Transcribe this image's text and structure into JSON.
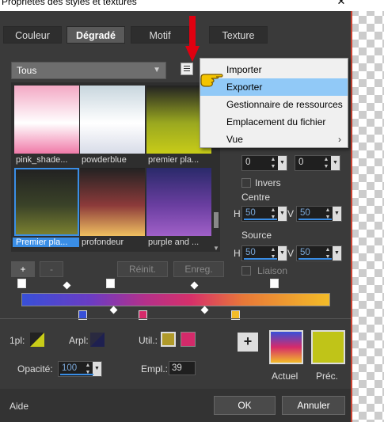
{
  "window": {
    "title": "Propriétés des styles et textures",
    "close": "✕"
  },
  "tabs": [
    "Couleur",
    "Dégradé",
    "Motif",
    "Texture"
  ],
  "category_select": "Tous",
  "gradients": [
    {
      "label": "pink_shade...",
      "top": "#f3a8c4",
      "mid": "#ffffff",
      "bot": "#f07aa8"
    },
    {
      "label": "powderblue",
      "top": "#c8d6de",
      "mid": "#ffffff",
      "bot": "#d8dce8"
    },
    {
      "label": "premier pla...",
      "top": "#222",
      "mid": "#9aa820",
      "bot": "#c8cc18"
    },
    {
      "label": "Premier pla...",
      "top": "#222",
      "mid": "#3a4228",
      "bot": "#7a8030"
    },
    {
      "label": "profondeur",
      "top": "#222",
      "mid": "#8c3a3a",
      "bot": "#f0c060"
    },
    {
      "label": "purple and ...",
      "top": "#2a2a6a",
      "mid": "#6a3ea0",
      "bot": "#a060c8"
    }
  ],
  "selected_gradient_index": 3,
  "buttons": {
    "add": "+",
    "remove": "-",
    "reset": "Réinit.",
    "save": "Enreg."
  },
  "menu": {
    "items": [
      {
        "label": "Importer",
        "highlight": false
      },
      {
        "label": "Exporter",
        "highlight": true
      },
      {
        "label": "Gestionnaire de ressources",
        "highlight": false
      },
      {
        "label": "Emplacement du fichier",
        "highlight": false
      },
      {
        "label": "Vue",
        "highlight": false,
        "submenu": "›"
      }
    ]
  },
  "right": {
    "angle_a": "0",
    "angle_b": "0",
    "invers": "Invers",
    "centre": "Centre",
    "centre_h": "50",
    "centre_v": "50",
    "source": "Source",
    "source_h": "50",
    "source_v": "50",
    "h": "H",
    "v": "V",
    "liaison": "Liaison"
  },
  "bottom": {
    "fg_label": "1pl:",
    "arpl": "Arpl:",
    "util": "Util.:",
    "opacity_label": "Opacité:",
    "opacity": "100",
    "empl_label": "Empl.:",
    "empl": "39",
    "plus": "+",
    "actuel": "Actuel",
    "prec": "Préc.",
    "help": "Aide",
    "ok": "OK",
    "cancel": "Annuler"
  },
  "colors": {
    "util1": "#b09a2a",
    "util2": "#d42a6a",
    "prec": "#c0c418",
    "fg": "#c8cc18"
  }
}
